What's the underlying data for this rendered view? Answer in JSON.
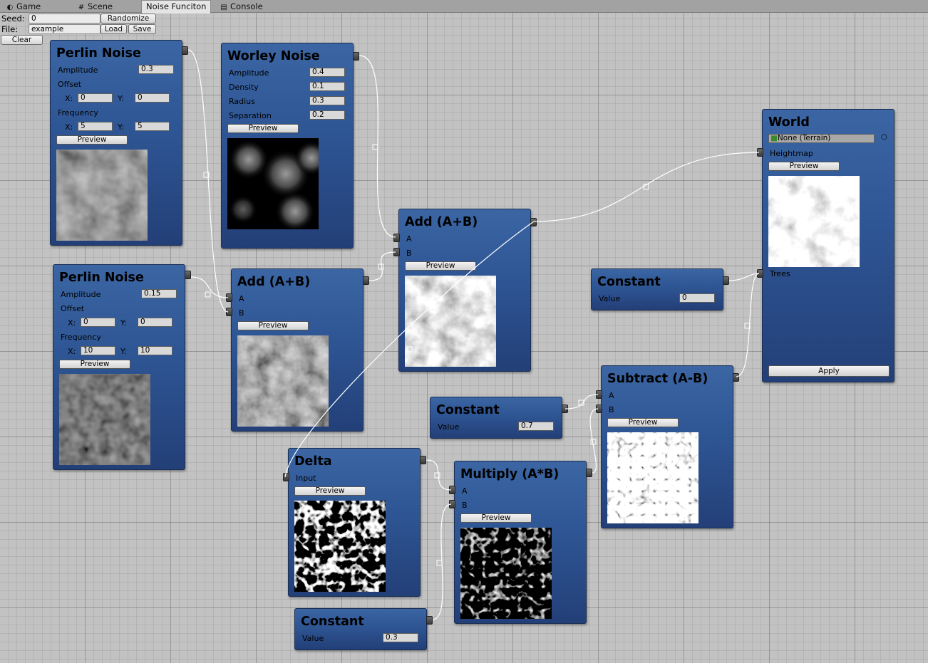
{
  "tabs": [
    {
      "label": "Game",
      "icon": "game-controller-icon"
    },
    {
      "label": "Scene",
      "icon": "scene-grid-icon"
    },
    {
      "label": "Noise Funciton",
      "icon": ""
    },
    {
      "label": "Console",
      "icon": "console-icon"
    }
  ],
  "controls": {
    "seed_label": "Seed:",
    "seed_value": "0",
    "randomize": "Randomize",
    "file_label": "File:",
    "file_value": "example",
    "load": "Load",
    "save": "Save",
    "clear": "Clear"
  },
  "nodes": {
    "perlin1": {
      "title": "Perlin Noise",
      "amplitude_label": "Amplitude",
      "amplitude": "0.3",
      "offset_label": "Offset",
      "x_label": "X:",
      "offset_x": "0",
      "y_label": "Y:",
      "offset_y": "0",
      "frequency_label": "Frequency",
      "freq_x": "5",
      "freq_y": "5",
      "preview": "Preview"
    },
    "perlin2": {
      "title": "Perlin Noise",
      "amplitude_label": "Amplitude",
      "amplitude": "0.15",
      "offset_label": "Offset",
      "x_label": "X:",
      "offset_x": "0",
      "y_label": "Y:",
      "offset_y": "0",
      "frequency_label": "Frequency",
      "freq_x": "10",
      "freq_y": "10",
      "preview": "Preview"
    },
    "worley": {
      "title": "Worley Noise",
      "amplitude_label": "Amplitude",
      "amplitude": "0.4",
      "density_label": "Density",
      "density": "0.1",
      "radius_label": "Radius",
      "radius": "0.3",
      "separation_label": "Separation",
      "separation": "0.2",
      "preview": "Preview"
    },
    "add1": {
      "title": "Add (A+B)",
      "a": "A",
      "b": "B",
      "preview": "Preview"
    },
    "add2": {
      "title": "Add (A+B)",
      "a": "A",
      "b": "B",
      "preview": "Preview"
    },
    "constant1": {
      "title": "Constant",
      "value_label": "Value",
      "value": "0"
    },
    "constant2": {
      "title": "Constant",
      "value_label": "Value",
      "value": "0.7"
    },
    "constant3": {
      "title": "Constant",
      "value_label": "Value",
      "value": "0.3"
    },
    "delta": {
      "title": "Delta",
      "input": "Input",
      "preview": "Preview"
    },
    "multiply": {
      "title": "Multiply (A*B)",
      "a": "A",
      "b": "B",
      "preview": "Preview"
    },
    "subtract": {
      "title": "Subtract (A-B)",
      "a": "A",
      "b": "B",
      "preview": "Preview"
    },
    "world": {
      "title": "World",
      "terrain": "None (Terrain)",
      "heightmap": "Heightmap",
      "preview": "Preview",
      "trees": "Trees",
      "apply": "Apply"
    }
  }
}
